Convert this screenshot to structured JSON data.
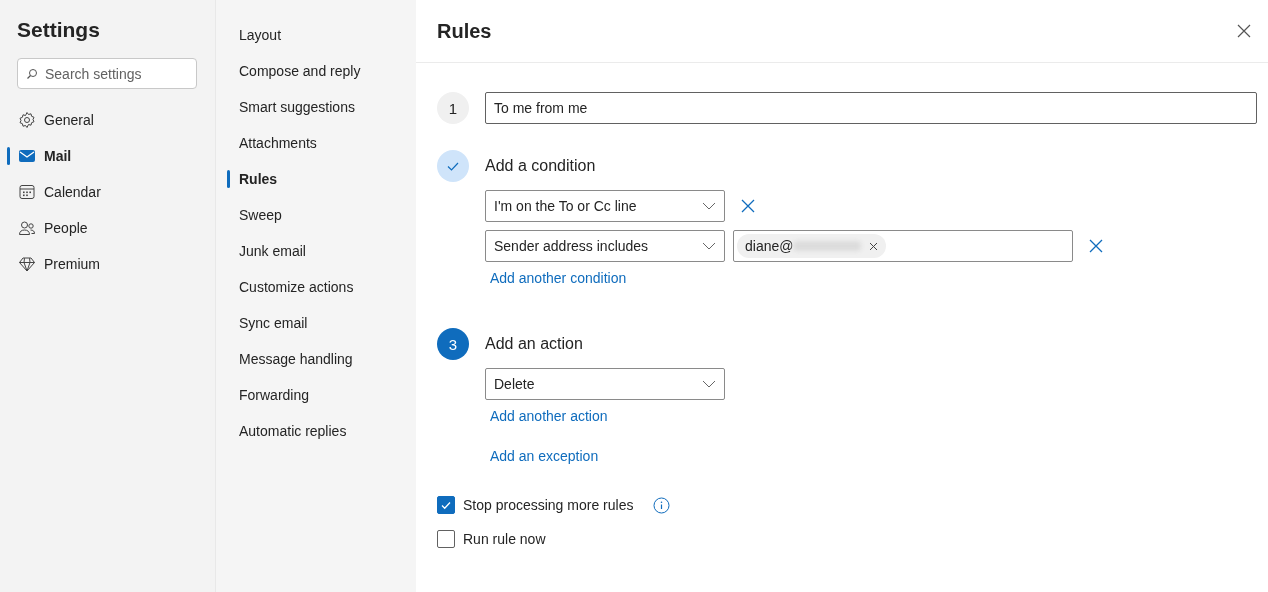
{
  "settings": {
    "title": "Settings",
    "search": {
      "placeholder": "Search settings"
    },
    "items": [
      {
        "label": "General",
        "selected": false
      },
      {
        "label": "Mail",
        "selected": true
      },
      {
        "label": "Calendar",
        "selected": false
      },
      {
        "label": "People",
        "selected": false
      },
      {
        "label": "Premium",
        "selected": false
      }
    ]
  },
  "submenu": [
    {
      "label": "Layout",
      "selected": false
    },
    {
      "label": "Compose and reply",
      "selected": false
    },
    {
      "label": "Smart suggestions",
      "selected": false
    },
    {
      "label": "Attachments",
      "selected": false
    },
    {
      "label": "Rules",
      "selected": true
    },
    {
      "label": "Sweep",
      "selected": false
    },
    {
      "label": "Junk email",
      "selected": false
    },
    {
      "label": "Customize actions",
      "selected": false
    },
    {
      "label": "Sync email",
      "selected": false
    },
    {
      "label": "Message handling",
      "selected": false
    },
    {
      "label": "Forwarding",
      "selected": false
    },
    {
      "label": "Automatic replies",
      "selected": false
    }
  ],
  "rules": {
    "title": "Rules",
    "name_step": {
      "number": "1",
      "value": "To me from me"
    },
    "condition_step": {
      "kind": "done",
      "title": "Add a condition",
      "conditions": [
        {
          "value": "I'm on the To or Cc line"
        },
        {
          "value": "Sender address includes",
          "chip": "diane@"
        }
      ],
      "add_link": "Add another condition"
    },
    "action_step": {
      "number": "3",
      "active": true,
      "title": "Add an action",
      "value": "Delete",
      "add_link": "Add another action"
    },
    "exception_link": "Add an exception",
    "options": [
      {
        "label": "Stop processing more rules",
        "checked": true,
        "info": true
      },
      {
        "label": "Run rule now",
        "checked": false,
        "info": false
      }
    ]
  }
}
